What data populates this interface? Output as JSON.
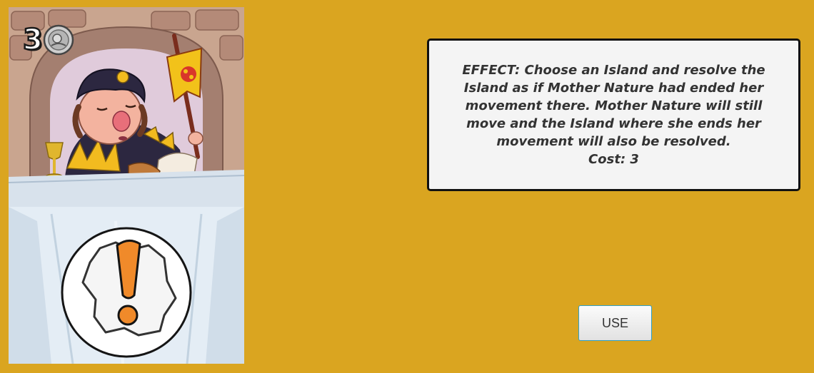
{
  "card": {
    "cost": "3",
    "coin_icon": "coin-with-character-icon",
    "illustration": "herald-with-banner-at-table",
    "symbol_icon": "exclamation-mark-icon"
  },
  "effect": {
    "text": "EFFECT: Choose an Island and resolve the Island as if Mother Nature had ended her movement there. Mother Nature will still move and the Island where she ends her movement will also be resolved.",
    "cost_line": "Cost: 3"
  },
  "actions": {
    "use_label": "USE"
  },
  "colors": {
    "background": "#DAA520",
    "panel": "#F4F4F4",
    "button_border": "#2FA0C8",
    "exclamation": "#F08A2A"
  }
}
